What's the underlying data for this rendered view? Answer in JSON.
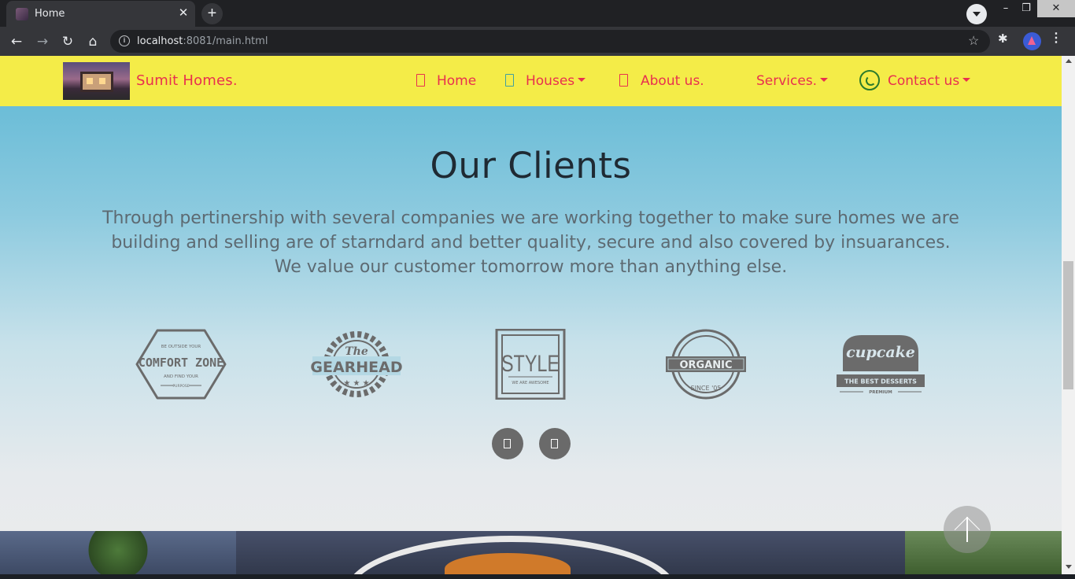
{
  "browser": {
    "tab_title": "Home",
    "tab_close": "✕",
    "new_tab": "+",
    "url_host": "localhost",
    "url_rest": ":8081/main.html",
    "window_controls": {
      "minimize": "–",
      "maximize": "❐",
      "close": "✕"
    },
    "icons": [
      "back-icon",
      "forward-icon",
      "reload-icon",
      "home-icon",
      "info-icon",
      "bookmark-star-icon",
      "extensions-icon",
      "profile-avatar",
      "menu-icon"
    ]
  },
  "navbar": {
    "brand": "Sumit Homes.",
    "items": [
      {
        "label": "Home",
        "icon": "home-icon",
        "dropdown": false
      },
      {
        "label": "Houses",
        "icon": "house-icon",
        "dropdown": true
      },
      {
        "label": "About us.",
        "icon": "info-icon",
        "dropdown": false
      },
      {
        "label": "Services.",
        "icon": "",
        "dropdown": true
      },
      {
        "label": "Contact us",
        "icon": "whatsapp-icon",
        "dropdown": true
      }
    ],
    "colors": {
      "background": "#f4ec48",
      "text": "#e8304f",
      "whatsapp": "#2b7a2b"
    }
  },
  "clients": {
    "title": "Our Clients",
    "description": "Through pertinership with several companies we are working together to make sure homes we are building and selling are of starndard and better quality, secure and also covered by insuarances. We value our customer tomorrow  more than anything else.",
    "logos": [
      {
        "name": "comfort-zone-logo",
        "top": "BE OUTSIDE YOUR",
        "main": "COMFORT ZONE",
        "sub": "AND FIND YOUR",
        "tiny": "PURPOSE"
      },
      {
        "name": "gearhead-logo",
        "top": "The",
        "main": "GEARHEAD"
      },
      {
        "name": "style-logo",
        "main": "STYLE",
        "sub": "WE ARE AWESOME"
      },
      {
        "name": "organic-logo",
        "main": "ORGANIC",
        "sub": "SINCE '05"
      },
      {
        "name": "cupcake-logo",
        "main": "cupcake",
        "sub": "THE BEST DESSERTS",
        "tiny": "PREMIUM"
      }
    ]
  }
}
